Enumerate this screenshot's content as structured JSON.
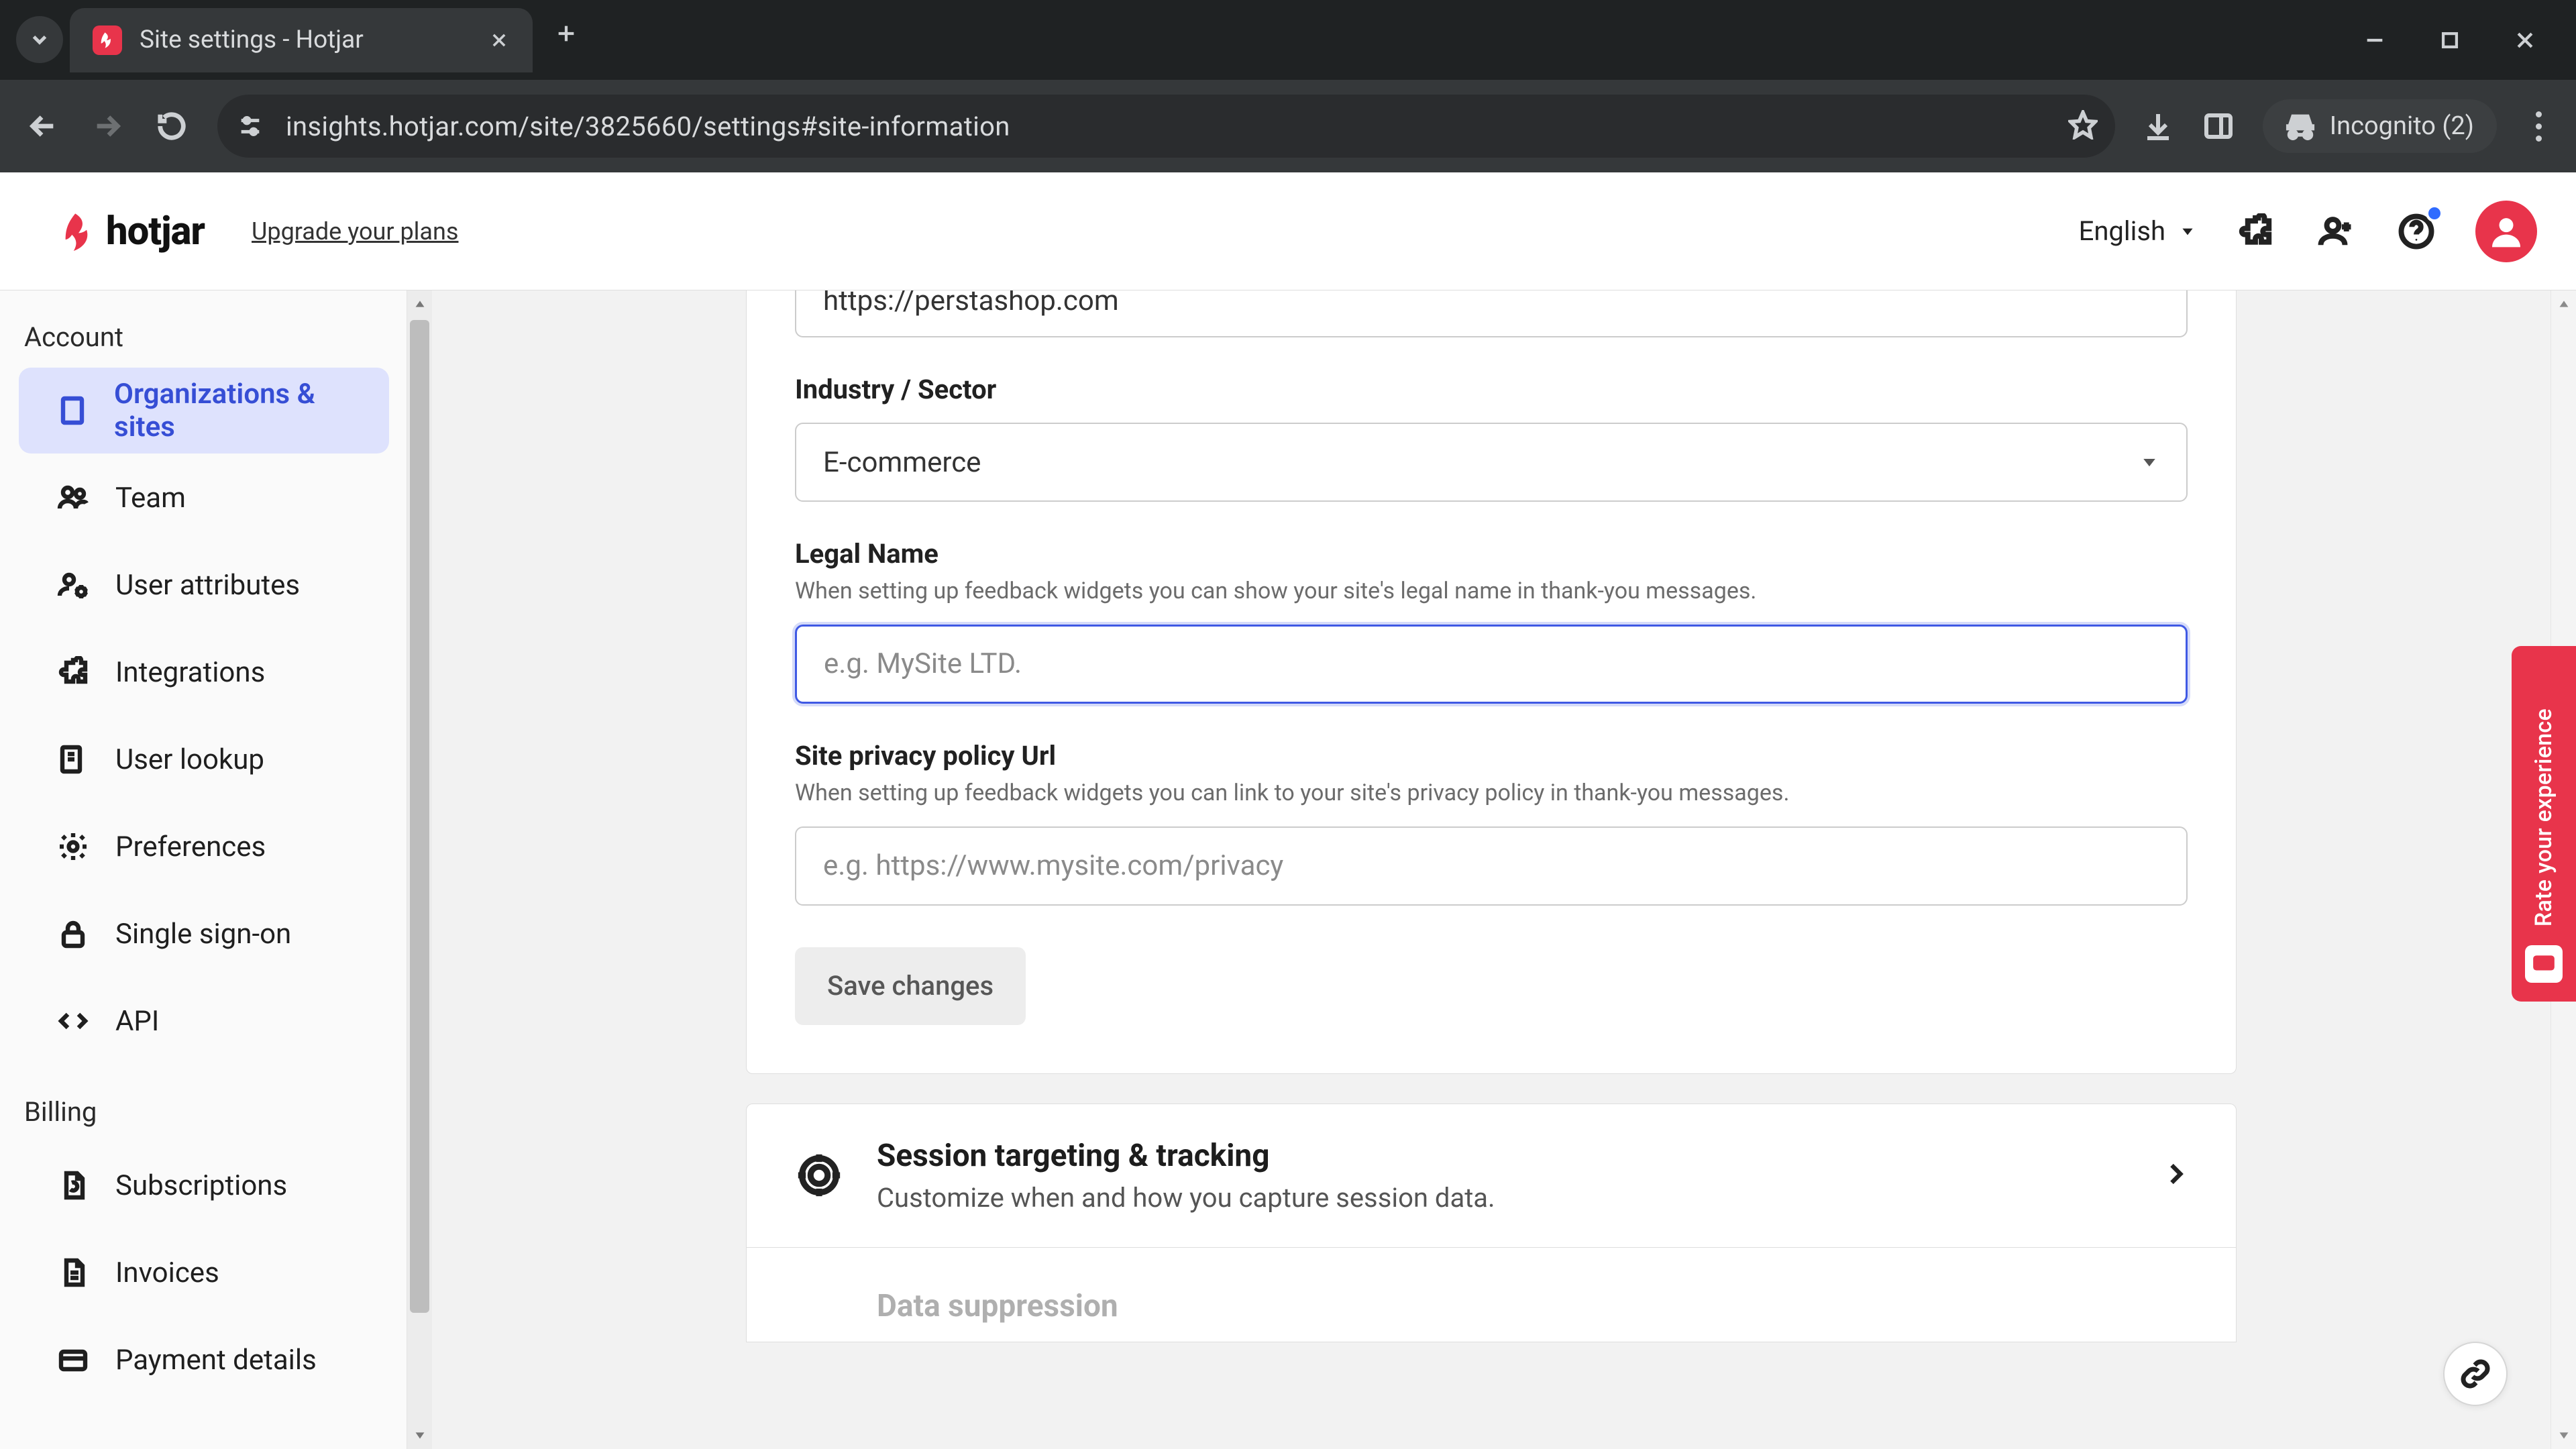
{
  "browser": {
    "tab_title": "Site settings - Hotjar",
    "url": "insights.hotjar.com/site/3825660/settings#site-information",
    "incognito_label": "Incognito (2)"
  },
  "header": {
    "brand": "hotjar",
    "upgrade_link": "Upgrade your plans",
    "language": "English"
  },
  "sidebar": {
    "group_account": "Account",
    "group_billing": "Billing",
    "items_account": [
      "Organizations & sites",
      "Team",
      "User attributes",
      "Integrations",
      "User lookup",
      "Preferences",
      "Single sign-on",
      "API"
    ],
    "items_billing": [
      "Subscriptions",
      "Invoices",
      "Payment details"
    ]
  },
  "settings": {
    "url_field_value": "https://perstashop.com",
    "industry_label": "Industry / Sector",
    "industry_value": "E-commerce",
    "legal_name_label": "Legal Name",
    "legal_name_help": "When setting up feedback widgets you can show your site's legal name in thank-you messages.",
    "legal_name_placeholder": "e.g. MySite LTD.",
    "legal_name_value": "",
    "privacy_label": "Site privacy policy Url",
    "privacy_help": "When setting up feedback widgets you can link to your site's privacy policy in thank-you messages.",
    "privacy_placeholder": "e.g. https://www.mysite.com/privacy",
    "privacy_value": "",
    "save_button": "Save changes"
  },
  "nav_rows": {
    "row1_title": "Session targeting & tracking",
    "row1_sub": "Customize when and how you capture session data.",
    "row2_title": "Data suppression"
  },
  "feedback_tab": "Rate your experience"
}
